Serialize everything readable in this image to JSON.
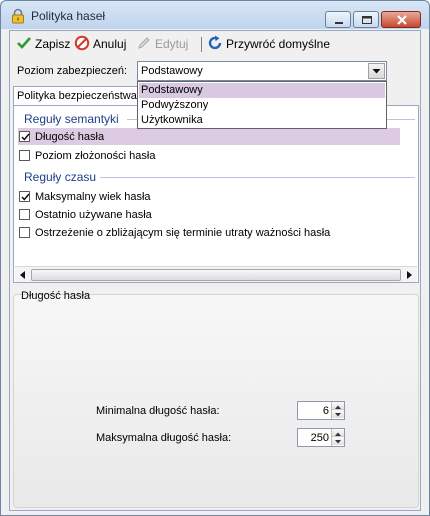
{
  "window": {
    "title": "Polityka haseł"
  },
  "toolbar": {
    "save_label": "Zapisz",
    "cancel_label": "Anuluj",
    "edit_label": "Edytuj",
    "restore_label": "Przywróć domyślne"
  },
  "security_level": {
    "label": "Poziom zabezpieczeń:",
    "selected": "Podstawowy",
    "options": [
      "Podstawowy",
      "Podwyższony",
      "Użytkownika"
    ]
  },
  "tab": {
    "label": "Polityka bezpieczeństwa"
  },
  "groups": {
    "semantic": {
      "heading": "Reguły semantyki",
      "rules": [
        {
          "label": "Długość hasła",
          "checked": true,
          "highlighted": true
        },
        {
          "label": "Poziom złożoności hasła",
          "checked": false,
          "highlighted": false
        }
      ]
    },
    "time": {
      "heading": "Reguły czasu",
      "rules": [
        {
          "label": "Maksymalny wiek hasła",
          "checked": true
        },
        {
          "label": "Ostatnio używane hasła",
          "checked": false
        },
        {
          "label": "Ostrzeżenie o zbliżającym się terminie utraty ważności hasła",
          "checked": false
        }
      ]
    }
  },
  "detail": {
    "title": "Długość hasła",
    "min_label": "Minimalna długość hasła:",
    "min_value": "6",
    "max_label": "Maksymalna długość hasła:",
    "max_value": "250"
  }
}
